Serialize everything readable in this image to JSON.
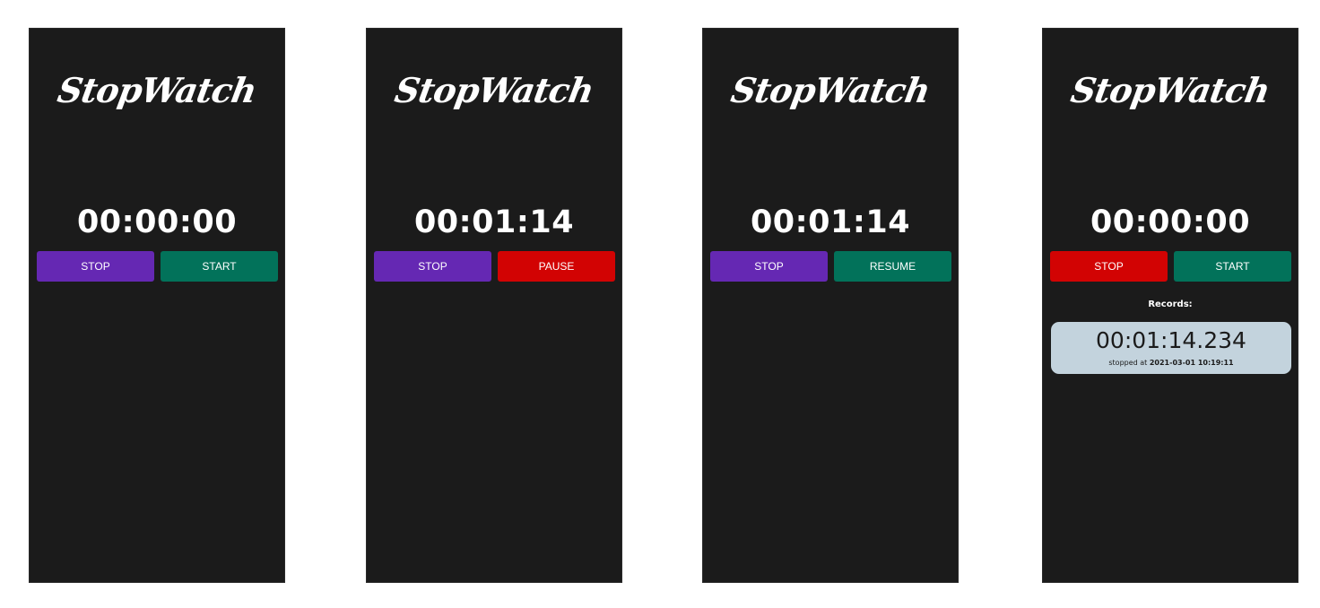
{
  "colors": {
    "screen_bg": "#1b1b1b",
    "purple": "#6528b3",
    "red": "#d20303",
    "green": "#02725a",
    "record_card": "#c3d3dd"
  },
  "screens": [
    {
      "title": "StopWatch",
      "time": "00:00:00",
      "left_button": {
        "label": "STOP",
        "color": "#6528b3"
      },
      "right_button": {
        "label": "START",
        "color": "#02725a"
      }
    },
    {
      "title": "StopWatch",
      "time": "00:01:14",
      "left_button": {
        "label": "STOP",
        "color": "#6528b3"
      },
      "right_button": {
        "label": "PAUSE",
        "color": "#d20303"
      }
    },
    {
      "title": "StopWatch",
      "time": "00:01:14",
      "left_button": {
        "label": "STOP",
        "color": "#6528b3"
      },
      "right_button": {
        "label": "RESUME",
        "color": "#02725a"
      }
    },
    {
      "title": "StopWatch",
      "time": "00:00:00",
      "left_button": {
        "label": "STOP",
        "color": "#d20303"
      },
      "right_button": {
        "label": "START",
        "color": "#02725a"
      },
      "records_label": "Records:",
      "records": [
        {
          "time": "00:01:14.234",
          "stopped_prefix": "stopped at",
          "stopped_at": "2021-03-01 10:19:11"
        }
      ]
    }
  ]
}
